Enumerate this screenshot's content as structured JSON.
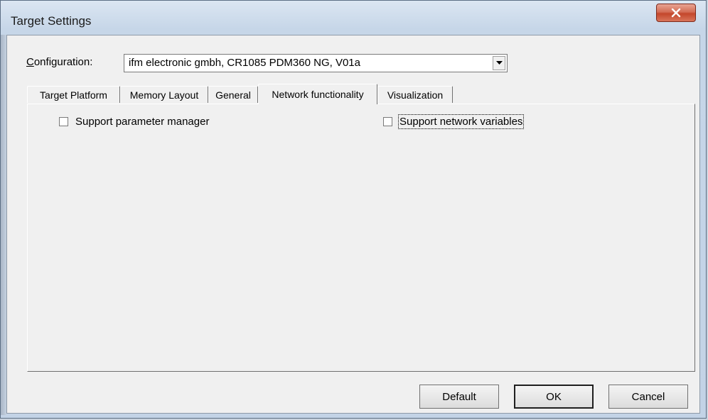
{
  "window": {
    "title": "Target Settings",
    "close_glyph": "X"
  },
  "configuration": {
    "label": "Configuration:",
    "value": "ifm electronic gmbh, CR1085 PDM360 NG, V01a",
    "dropdown_icon": "chevron-down-icon"
  },
  "tabs": [
    {
      "label": "Target Platform",
      "active": false
    },
    {
      "label": "Memory Layout",
      "active": false
    },
    {
      "label": "General",
      "active": false
    },
    {
      "label": "Network functionality",
      "active": true
    },
    {
      "label": "Visualization",
      "active": false
    }
  ],
  "options": {
    "param_manager": {
      "label": "Support parameter manager",
      "checked": false
    },
    "network_vars": {
      "label": "Support network variables",
      "checked": false
    }
  },
  "buttons": {
    "default": "Default",
    "ok": "OK",
    "cancel": "Cancel"
  },
  "colors": {
    "close_button": "#c3472b",
    "dialog_face": "#f0f0f0",
    "frame": "#c6d6e8"
  }
}
